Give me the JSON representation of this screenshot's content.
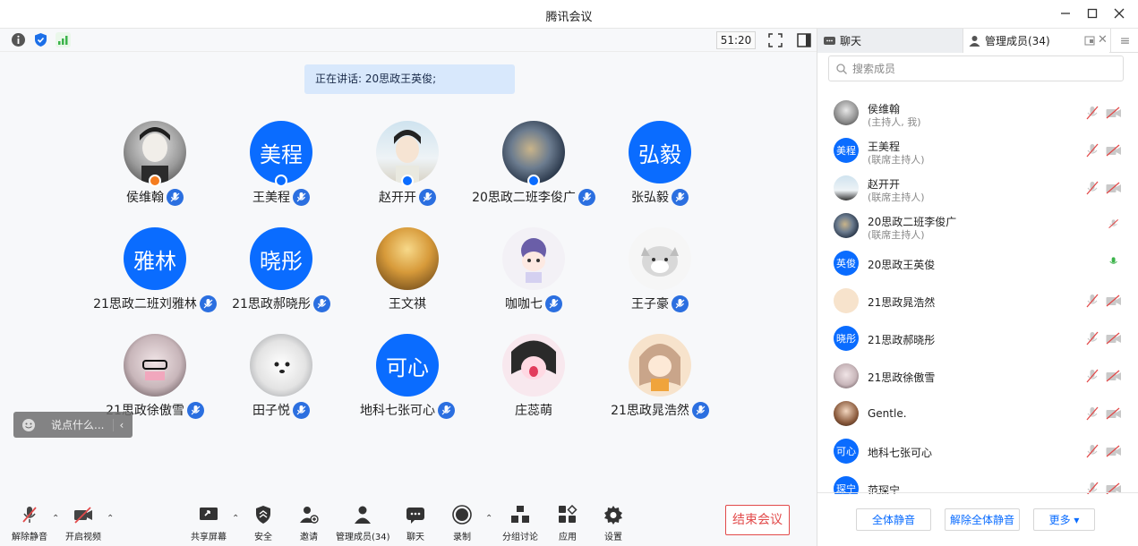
{
  "window": {
    "title": "腾讯会议"
  },
  "toolbar_top": {
    "timer": "51:20"
  },
  "speaking": "正在讲话: 20思政王英俊;",
  "chat_box_placeholder": "说点什么...",
  "chat_box_collapse": "‹",
  "tiles": [
    {
      "name": "侯维翰",
      "avatar_text": "",
      "badge": "host",
      "mic": true
    },
    {
      "name": "王美程",
      "avatar_text": "美程",
      "badge": "cohost",
      "mic": true
    },
    {
      "name": "赵开开",
      "avatar_text": "",
      "badge": "cohost",
      "mic": true
    },
    {
      "name": "20思政二班李俊广",
      "avatar_text": "",
      "badge": "cohost",
      "mic": true
    },
    {
      "name": "张弘毅",
      "avatar_text": "弘毅",
      "badge": "",
      "mic": true
    },
    {
      "name": "21思政二班刘雅林",
      "avatar_text": "雅林",
      "badge": "",
      "mic": true
    },
    {
      "name": "21思政郝晓彤",
      "avatar_text": "晓彤",
      "badge": "",
      "mic": true
    },
    {
      "name": "王文祺",
      "avatar_text": "",
      "badge": "",
      "mic": false
    },
    {
      "name": "咖咖七",
      "avatar_text": "",
      "badge": "",
      "mic": true
    },
    {
      "name": "王子豪",
      "avatar_text": "",
      "badge": "",
      "mic": true
    },
    {
      "name": "21思政徐傲雪",
      "avatar_text": "",
      "badge": "",
      "mic": true
    },
    {
      "name": "田子悦",
      "avatar_text": "",
      "badge": "",
      "mic": true
    },
    {
      "name": "地科七张可心",
      "avatar_text": "可心",
      "badge": "",
      "mic": true
    },
    {
      "name": "庄蕊萌",
      "avatar_text": "",
      "badge": "",
      "mic": false
    },
    {
      "name": "21思政晁浩然",
      "avatar_text": "",
      "badge": "",
      "mic": true
    }
  ],
  "bottom_toolbar": {
    "unmute": "解除静音",
    "start_video": "开启视频",
    "share_screen": "共享屏幕",
    "security": "安全",
    "invite": "邀请",
    "manage_members": "管理成员(34)",
    "chat": "聊天",
    "record": "录制",
    "breakout": "分组讨论",
    "apps": "应用",
    "settings": "设置",
    "end_meeting": "结束会议"
  },
  "sidebar": {
    "tab_chat": "聊天",
    "tab_members": "管理成员(34)",
    "search_placeholder": "搜索成员",
    "members": [
      {
        "name": "侯维翰",
        "role": "(主持人, 我)",
        "avatar_text": "",
        "mic": "muted",
        "cam": "off"
      },
      {
        "name": "王美程",
        "role": "(联席主持人)",
        "avatar_text": "美程",
        "mic": "muted",
        "cam": "off"
      },
      {
        "name": "赵开开",
        "role": "(联席主持人)",
        "avatar_text": "",
        "mic": "muted",
        "cam": "off"
      },
      {
        "name": "20思政二班李俊广",
        "role": "(联席主持人)",
        "avatar_text": "",
        "mic": "muted",
        "cam": "none"
      },
      {
        "name": "20思政王英俊",
        "role": "",
        "avatar_text": "英俊",
        "mic": "active",
        "cam": "none"
      },
      {
        "name": "21思政晁浩然",
        "role": "",
        "avatar_text": "",
        "mic": "muted",
        "cam": "off"
      },
      {
        "name": "21思政郝晓彤",
        "role": "",
        "avatar_text": "晓彤",
        "mic": "muted",
        "cam": "off"
      },
      {
        "name": "21思政徐傲雪",
        "role": "",
        "avatar_text": "",
        "mic": "muted",
        "cam": "off"
      },
      {
        "name": "Gentle.",
        "role": "",
        "avatar_text": "",
        "mic": "muted",
        "cam": "off"
      },
      {
        "name": "地科七张可心",
        "role": "",
        "avatar_text": "可心",
        "mic": "muted",
        "cam": "off"
      },
      {
        "name": "范琛宁",
        "role": "",
        "avatar_text": "琛宁",
        "mic": "muted",
        "cam": "off"
      }
    ],
    "mute_all": "全体静音",
    "unmute_all": "解除全体静音",
    "more": "更多 ▾"
  },
  "colors": {
    "accent": "#0a6cff",
    "danger": "#e24a4a",
    "mic_badge": "#2b6fe0",
    "host_badge": "#f57c1f",
    "active_mic": "#3bb34a"
  }
}
